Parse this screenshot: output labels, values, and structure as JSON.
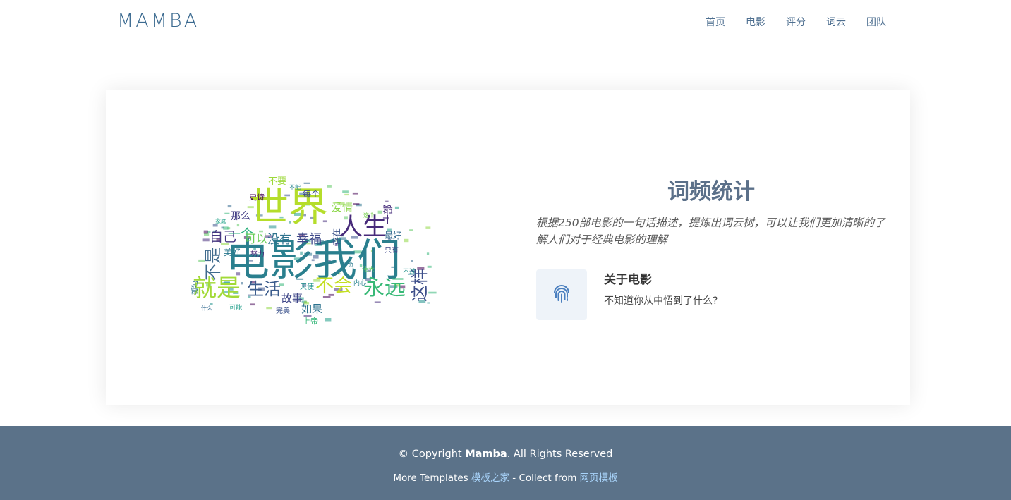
{
  "header": {
    "logo": "MAMBA",
    "nav": [
      "首页",
      "电影",
      "评分",
      "词云",
      "团队"
    ]
  },
  "section": {
    "title": "词频统计",
    "description": "根据250部电影的一句话描述，提炼出词云树，可以让我们更加清晰的了解人们对于经典电影的理解",
    "feature": {
      "icon": "fingerprint-icon",
      "title": "关于电影",
      "text": "不知道你从中悟到了什么?"
    }
  },
  "wordcloud": {
    "words": [
      {
        "text": "电影我们",
        "color": "#2a7f8e"
      },
      {
        "text": "世界",
        "color": "#b5dd2b"
      },
      {
        "text": "人生",
        "color": "#472a7a"
      },
      {
        "text": "就是",
        "color": "#a2da37"
      },
      {
        "text": "永远",
        "color": "#38b977"
      },
      {
        "text": "生活",
        "color": "#3b5c8c"
      },
      {
        "text": "不会",
        "color": "#c4df24"
      },
      {
        "text": "这样",
        "color": "#3d4e8a"
      },
      {
        "text": "不是",
        "color": "#3f6a8c"
      },
      {
        "text": "自己",
        "color": "#453781"
      },
      {
        "text": "一个",
        "color": "#2db17d"
      },
      {
        "text": "可以",
        "color": "#6cce59"
      },
      {
        "text": "没有",
        "color": "#2f738e"
      },
      {
        "text": "幸福",
        "color": "#3e4989"
      },
      {
        "text": "爱情",
        "color": "#8bd646"
      },
      {
        "text": "故事",
        "color": "#3f4788"
      },
      {
        "text": "如果",
        "color": "#2c728e"
      },
      {
        "text": "不要",
        "color": "#9dd93b"
      },
      {
        "text": "每个",
        "color": "#3e4c8a"
      },
      {
        "text": "那么",
        "color": "#433e85"
      },
      {
        "text": "最好",
        "color": "#31688e"
      },
      {
        "text": "美好",
        "color": "#2a788e"
      },
      {
        "text": "上帝",
        "color": "#35b779"
      },
      {
        "text": "史诗",
        "color": "#440154"
      },
      {
        "text": "天使",
        "color": "#20928c"
      },
      {
        "text": "内心",
        "color": "#26828e"
      },
      {
        "text": "完美",
        "color": "#3b528b"
      },
      {
        "text": "孤独",
        "color": "#2c728e"
      },
      {
        "text": "努力",
        "color": "#482878"
      },
      {
        "text": "可能",
        "color": "#1f9e89"
      },
      {
        "text": "存在",
        "color": "#3b528b"
      },
      {
        "text": "一部",
        "color": "#472d7b"
      },
      {
        "text": "什么",
        "color": "#31688e"
      },
      {
        "text": "不过",
        "color": "#21918c"
      },
      {
        "text": "伟大",
        "color": "#5ec962"
      },
      {
        "text": "生命",
        "color": "#29798e"
      },
      {
        "text": "家庭",
        "color": "#1fa187"
      },
      {
        "text": "只有",
        "color": "#3f4889"
      },
      {
        "text": "不能",
        "color": "#25858e"
      },
      {
        "text": "这个",
        "color": "#7ad151"
      }
    ]
  },
  "footer": {
    "copyright_prefix": "© Copyright ",
    "copyright_brand": "Mamba",
    "copyright_suffix": ". All Rights Reserved",
    "more_label": "More Templates ",
    "more_link": "模板之家",
    "collect_label": " - Collect from ",
    "collect_link": "网页模板"
  }
}
